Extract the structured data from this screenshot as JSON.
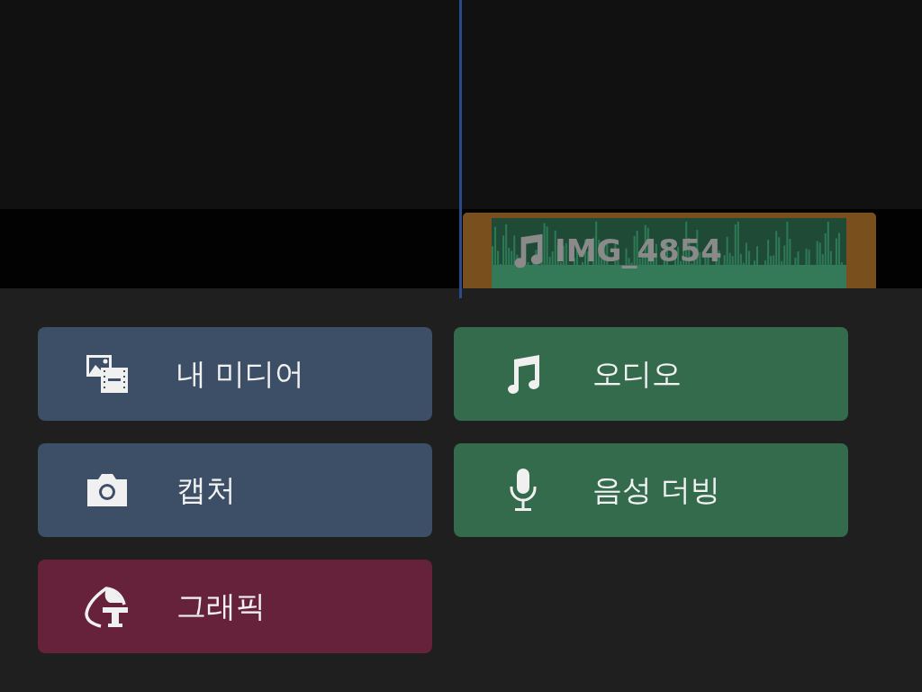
{
  "timeline": {
    "clip": {
      "label": "IMG_4854"
    }
  },
  "buttons": [
    {
      "label": "내 미디어",
      "kind": "media",
      "color": "#3d4f66"
    },
    {
      "label": "오디오",
      "kind": "audio",
      "color": "#356b4d"
    },
    {
      "label": "캡처",
      "kind": "capture",
      "color": "#3d4f66"
    },
    {
      "label": "음성 더빙",
      "kind": "voiceover",
      "color": "#356b4d"
    },
    {
      "label": "그래픽",
      "kind": "graphic",
      "color": "#66213b"
    }
  ]
}
